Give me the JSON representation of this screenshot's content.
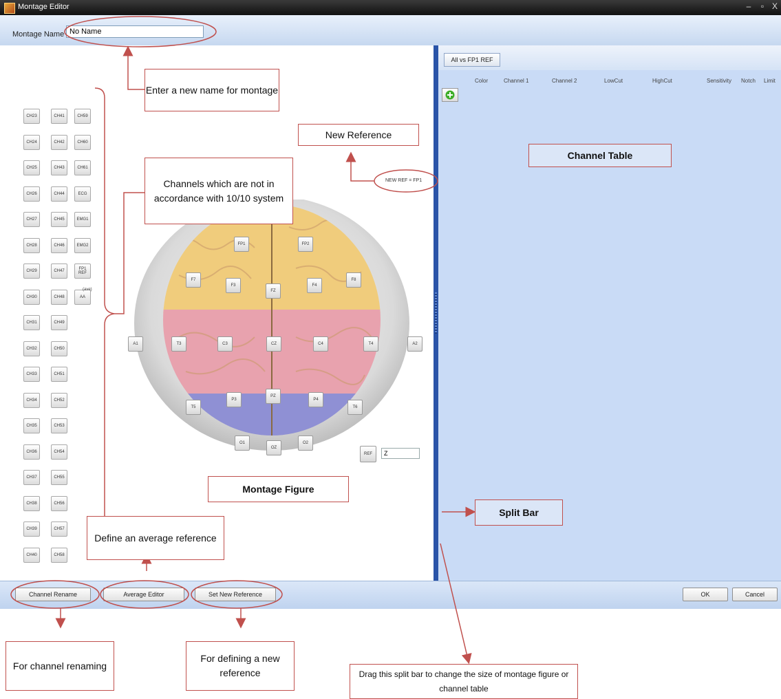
{
  "window": {
    "title": "Montage Editor",
    "controls": [
      "–",
      "▫",
      "X"
    ]
  },
  "montage": {
    "name_label": "Montage Name :",
    "name_value": "No Name"
  },
  "channel_columns": [
    [
      "CH23",
      "CH24",
      "CH25",
      "CH26",
      "CH27",
      "CH28",
      "CH29",
      "CH30",
      "CH31",
      "CH32",
      "CH33",
      "CH34",
      "CH35",
      "CH36",
      "CH37",
      "CH38",
      "CH39",
      "CH40"
    ],
    [
      "CH41",
      "CH42",
      "CH43",
      "CH44",
      "CH45",
      "CH46",
      "CH47",
      "CH48",
      "CH49",
      "CH50",
      "CH51",
      "CH52",
      "CH53",
      "CH54",
      "CH55",
      "CH56",
      "CH57",
      "CH58"
    ],
    [
      "CH59",
      "CH60",
      "CH61",
      "ECG",
      "EMG1",
      "EMG2",
      "FP1 REF",
      "AA"
    ]
  ],
  "aa_suffix": "(ave)",
  "electrodes": {
    "FP1": "FP1",
    "FP2": "FP2",
    "F7": "F7",
    "F3": "F3",
    "FZ": "FZ",
    "F4": "F4",
    "F8": "F8",
    "A1": "A1",
    "T3": "T3",
    "C3": "C3",
    "CZ": "CZ",
    "C4": "C4",
    "T4": "T4",
    "A2": "A2",
    "T5": "T5",
    "P3": "P3",
    "PZ": "PZ",
    "P4": "P4",
    "T6": "T6",
    "O1": "O1",
    "OZ": "OZ",
    "O2": "O2"
  },
  "reference": {
    "button": "REF",
    "value": "Z",
    "new_ref_label": "NEW REF = FP1"
  },
  "channel_table": {
    "tab": "All vs FP1 REF",
    "columns": [
      "Color",
      "Channel 1",
      "Channel 2",
      "LowCut",
      "HighCut",
      "Sensitivity",
      "Notch",
      "Limit"
    ]
  },
  "buttons": {
    "channel_rename": "Channel Rename",
    "average_editor": "Average Editor",
    "set_new_reference": "Set New Reference",
    "ok": "OK",
    "cancel": "Cancel"
  },
  "annotations": {
    "enter_name": "Enter a new name for montage",
    "new_reference": "New Reference",
    "channels_not_1010": "Channels which are not in accordance with 10/10 system",
    "channel_table": "Channel Table",
    "montage_figure": "Montage Figure",
    "split_bar": "Split Bar",
    "define_average": "Define an average reference",
    "channel_renaming": "For channel renaming",
    "defining_reference": "For defining a new reference",
    "drag_split": "Drag this split bar to change the size of montage figure or channel table"
  },
  "colors": {
    "annotation_border": "#c0504d",
    "split_bar": "#2a54a8",
    "panel_blue": "#c9dbf6",
    "frontal": "#f0cc7c",
    "central": "#e8a2ae",
    "occipital": "#8f90d4"
  }
}
